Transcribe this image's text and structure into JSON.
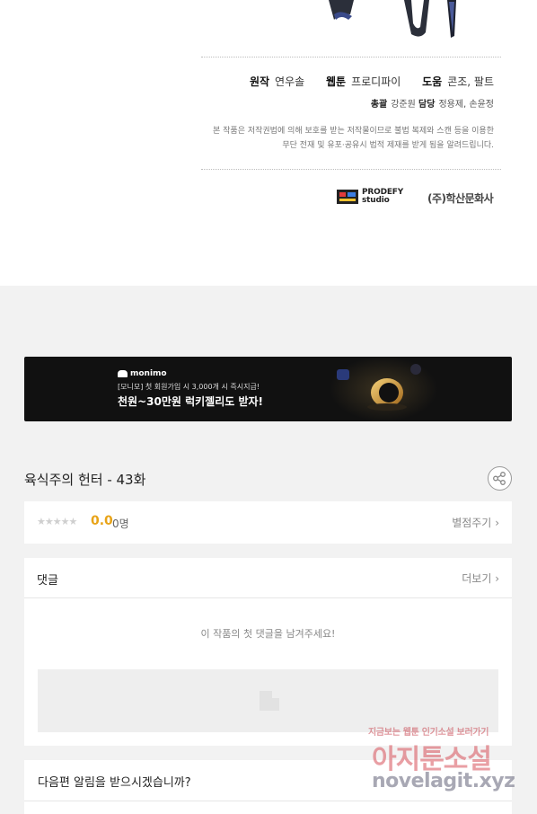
{
  "credits": {
    "original_label": "원작",
    "original_value": "연우솔",
    "webtoon_label": "웹툰",
    "webtoon_value": "프로디파이",
    "assist_label": "도움",
    "assist_value": "콘조, 팔트",
    "supervision_label": "총괄",
    "supervision_value": "강준원",
    "manager_label": "담당",
    "manager_value": "정용제, 손윤정",
    "notice_line1": "본 작품은 저작권법에 의해 보호를 받는 저작물이므로 불법 복제와 스캔 등을 이용한",
    "notice_line2": "무단 전재 및 유포·공유시 법적 제재를 받게 됨을 알려드립니다.",
    "studio_name_line1": "PRODEFY",
    "studio_name_line2": "studio",
    "publisher": "(주)학산문화사"
  },
  "banner": {
    "brand": "monimo",
    "line1": "[모니모] 첫 회원가입 시 3,000개 시 즉시지급!",
    "line2": "천원~30만원 럭키젤리도 받자!"
  },
  "episode": {
    "title": "육식주의 헌터 - 43화",
    "share_icon": "share-icon"
  },
  "rating": {
    "stars": "★★★★★",
    "score": "0.0",
    "voters": "0명",
    "rate_link": "별점주기",
    "colors": {
      "score": "#e8a317",
      "empty_star": "#cfcfcf"
    }
  },
  "comments": {
    "title": "댓글",
    "more": "더보기",
    "empty_message": "이 작품의 첫 댓글을 남겨주세요!"
  },
  "notify": {
    "text": "다음편 알림을 받으시겠습니까?"
  },
  "watermark": {
    "top": "지금보는 웹툰 인기소설 보러가기",
    "main": "아지툰소설",
    "url": "novelagit.xyz"
  },
  "chevron": "›"
}
